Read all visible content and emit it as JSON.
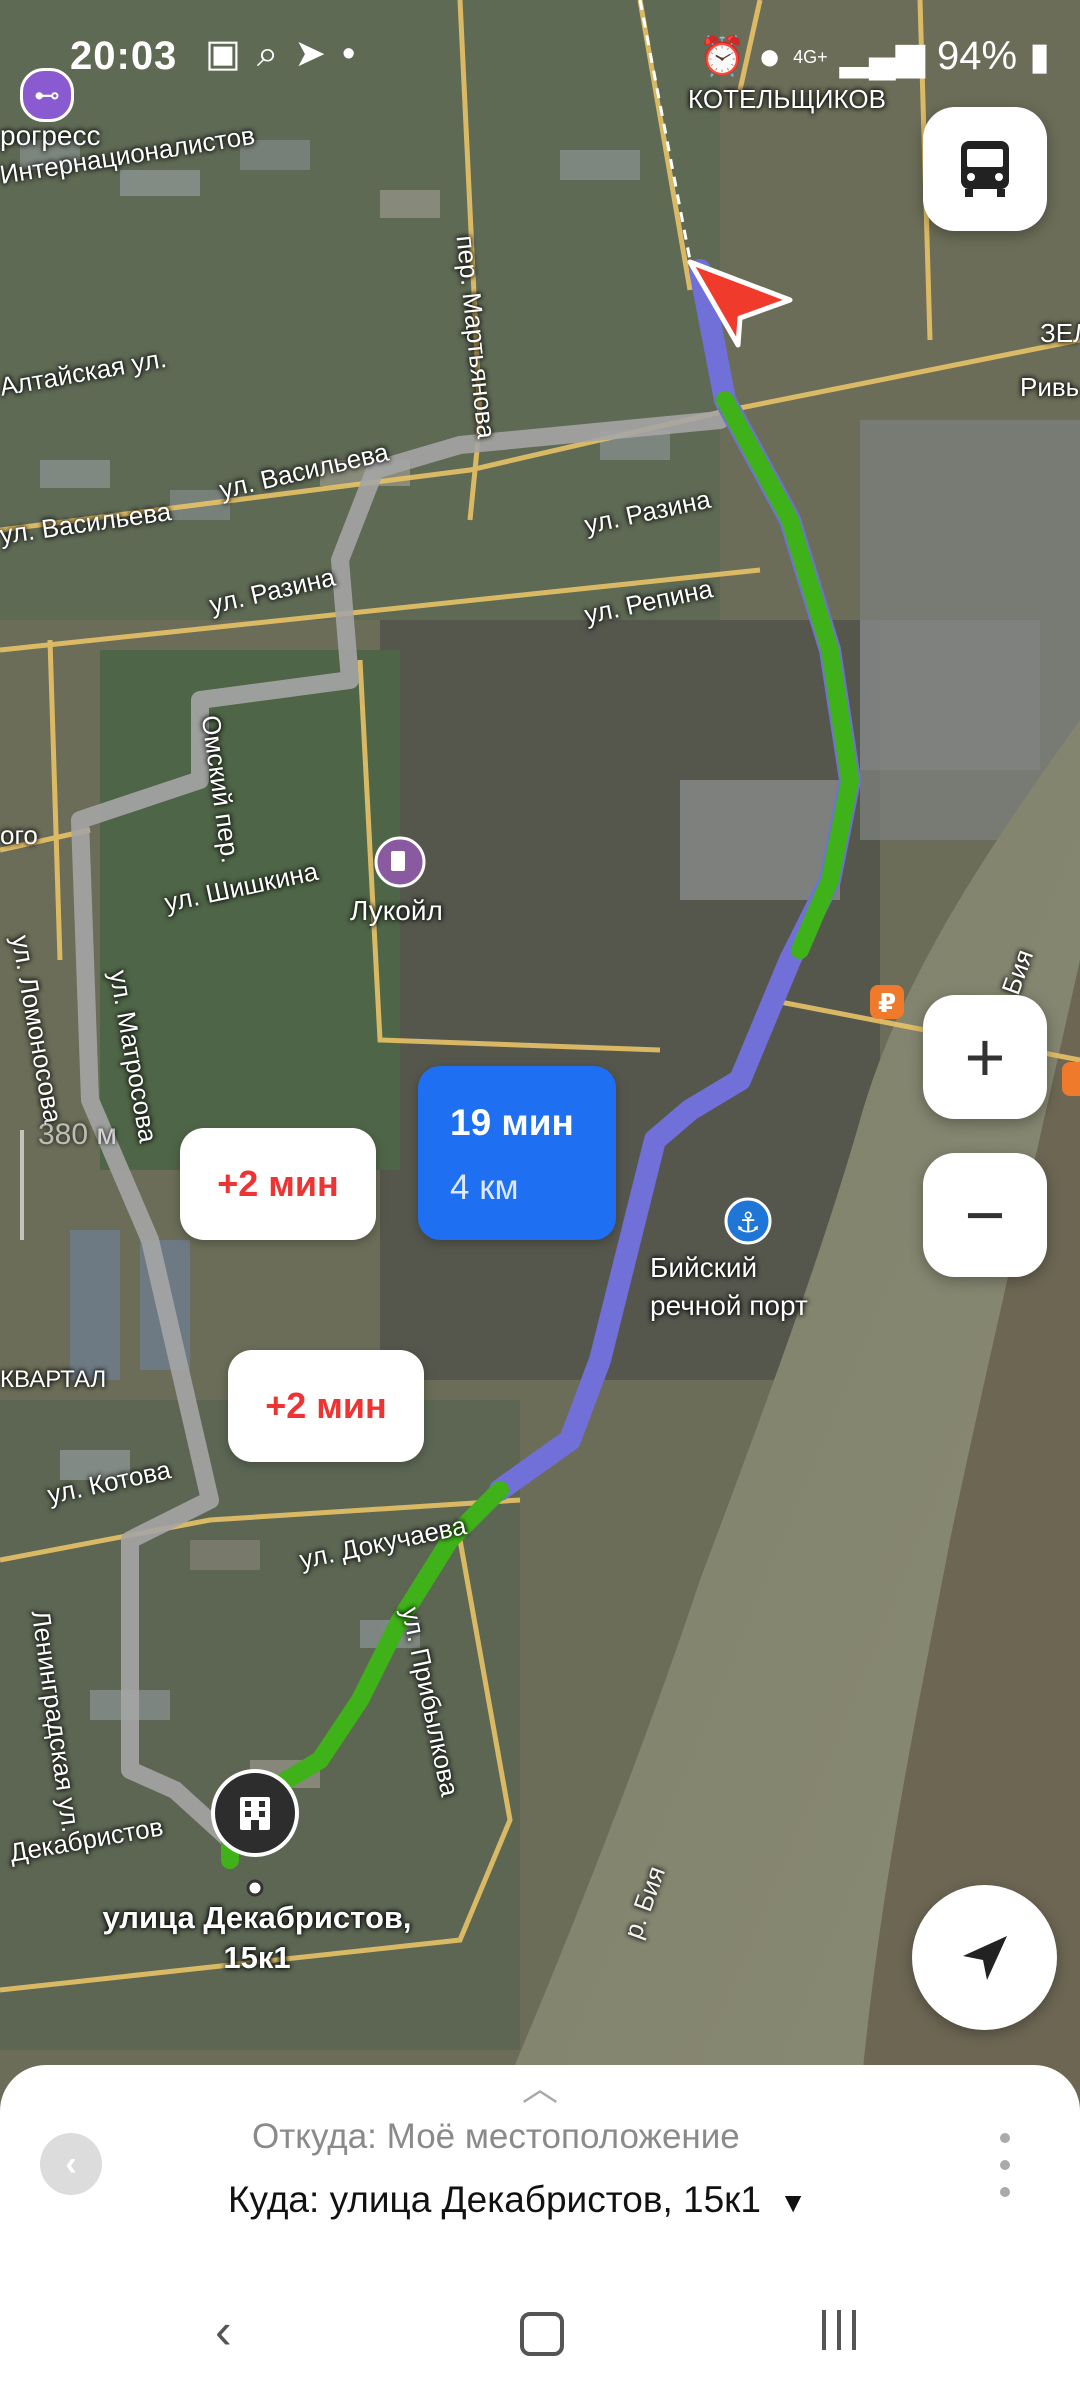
{
  "status_bar": {
    "time": "20:03",
    "network": "4G+",
    "battery": "94%"
  },
  "map": {
    "scale_label": "380 м"
  },
  "map_labels": [
    "рогресс",
    "Интернационалистов",
    "Алтайская ул.",
    "ул. Васильева",
    "ул. Васильева",
    "ул. Разина",
    "ул. Разина",
    "ул. Репина",
    "пер. Мартьянова",
    "КОТЕЛЬЩИКОВ",
    "Ривь",
    "Омский пер.",
    "ул. Шишкина",
    "Лукойл",
    "ул. Матросова",
    "ул. Ломоносова",
    "ого",
    "Бийский",
    "речной порт",
    "КВАРТАЛ",
    "ул. Котова",
    "ул. Докучаева",
    "ул. Прибылкова",
    "Ленинградская ул.",
    "Декабристов",
    "р. Бия",
    "Бия",
    "ЗЕЛ",
    ""
  ],
  "destination": {
    "label_line1": "улица Декабристов,",
    "label_line2": "15к1"
  },
  "route_bubbles": {
    "alt1": "+2 мин",
    "alt2": "+2 мин",
    "main_time": "19 мин",
    "main_distance": "4 км"
  },
  "route_sheet": {
    "from_label": "Откуда:",
    "from_value": "Моё местоположение",
    "to_label": "Куда:",
    "to_value": "улица Декабристов, 15к1"
  },
  "colors": {
    "route_main": "#7070d8",
    "route_fast": "#3fb21a",
    "route_alt": "#a5a5a5",
    "bubble_blue": "#1f6ff2",
    "delay_red": "#e33333"
  }
}
